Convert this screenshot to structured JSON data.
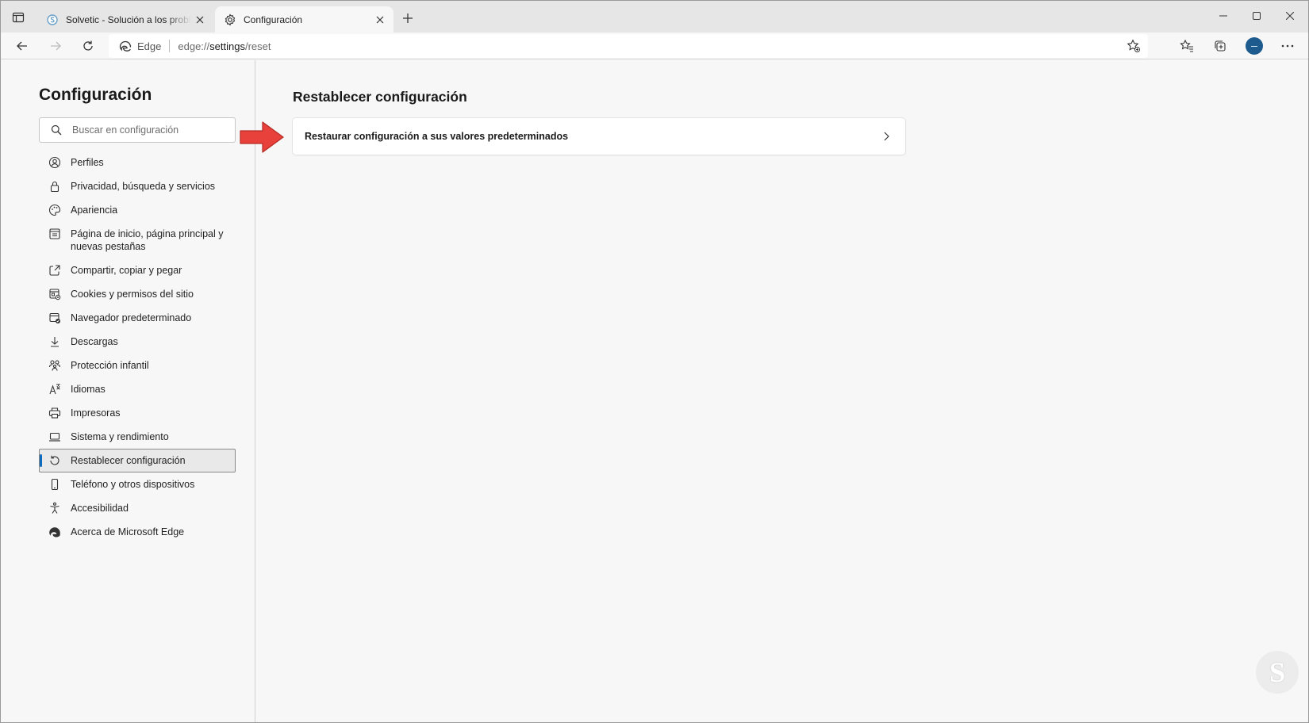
{
  "browser": {
    "tabs": [
      {
        "title": "Solvetic - Solución a los problem",
        "favicon": "solvetic-icon",
        "active": false
      },
      {
        "title": "Configuración",
        "favicon": "gear-icon",
        "active": true
      }
    ],
    "address_bar": {
      "site_label": "Edge",
      "url_prefix": "edge://",
      "url_path": "settings",
      "url_suffix": "/reset"
    }
  },
  "sidebar": {
    "title": "Configuración",
    "search_placeholder": "Buscar en configuración",
    "items": [
      {
        "label": "Perfiles",
        "icon": "profile-icon"
      },
      {
        "label": "Privacidad, búsqueda y servicios",
        "icon": "lock-icon"
      },
      {
        "label": "Apariencia",
        "icon": "palette-icon"
      },
      {
        "label": "Página de inicio, página principal y nuevas pestañas",
        "icon": "home-page-icon"
      },
      {
        "label": "Compartir, copiar y pegar",
        "icon": "share-icon"
      },
      {
        "label": "Cookies y permisos del sitio",
        "icon": "cookies-icon"
      },
      {
        "label": "Navegador predeterminado",
        "icon": "default-browser-icon"
      },
      {
        "label": "Descargas",
        "icon": "download-icon"
      },
      {
        "label": "Protección infantil",
        "icon": "family-icon"
      },
      {
        "label": "Idiomas",
        "icon": "language-icon"
      },
      {
        "label": "Impresoras",
        "icon": "printer-icon"
      },
      {
        "label": "Sistema y rendimiento",
        "icon": "laptop-icon"
      },
      {
        "label": "Restablecer configuración",
        "icon": "reset-icon",
        "active": true
      },
      {
        "label": "Teléfono y otros dispositivos",
        "icon": "phone-icon"
      },
      {
        "label": "Accesibilidad",
        "icon": "accessibility-icon"
      },
      {
        "label": "Acerca de Microsoft Edge",
        "icon": "edge-icon"
      }
    ]
  },
  "main": {
    "title": "Restablecer configuración",
    "card_label": "Restaurar configuración a sus valores predeterminados"
  },
  "colors": {
    "accent": "#0f6cbd",
    "annotation_arrow": "#e8403a",
    "avatar": "#1d5b8f"
  }
}
